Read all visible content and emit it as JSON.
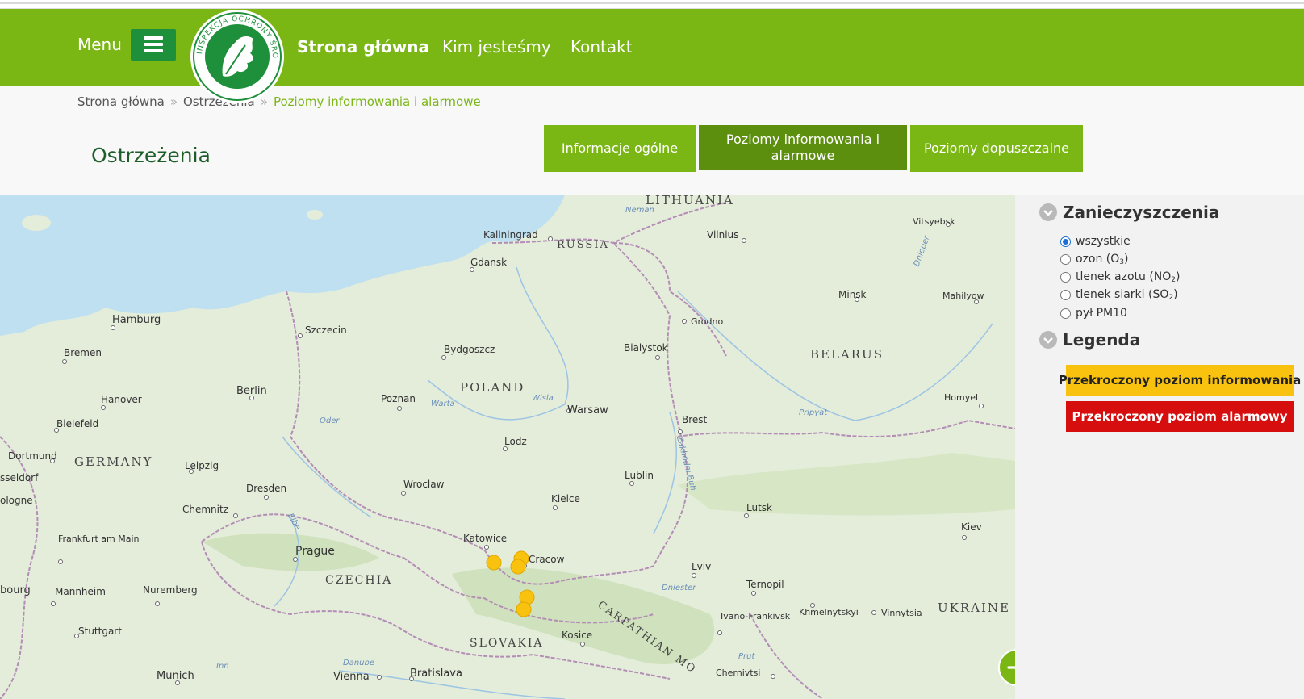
{
  "header": {
    "menu_label": "Menu",
    "logo_text": "INSPEKCJA OCHRONY ŚRODOWISKA",
    "nav": [
      {
        "label": "Strona główna"
      },
      {
        "label": "Kim jesteśmy"
      },
      {
        "label": "Kontakt"
      }
    ]
  },
  "breadcrumb": {
    "items": [
      "Strona główna",
      "Ostrzeżenia"
    ],
    "current": "Poziomy informowania i alarmowe",
    "separator": "»"
  },
  "page": {
    "title": "Ostrzeżenia",
    "tabs": [
      {
        "label": "Informacje ogólne",
        "active": false
      },
      {
        "label": "Poziomy informowania i alarmowe",
        "active": true
      },
      {
        "label": "Poziomy dopuszczalne",
        "active": false
      }
    ]
  },
  "sidebar": {
    "pollutants": {
      "title": "Zanieczyszczenia",
      "options": [
        {
          "label": "wszystkie",
          "checked": true
        },
        {
          "label": "ozon (O",
          "sub": "3",
          "tail": ")",
          "checked": false
        },
        {
          "label": "tlenek azotu (NO",
          "sub": "2",
          "tail": ")",
          "checked": false
        },
        {
          "label": "tlenek siarki (SO",
          "sub": "2",
          "tail": ")",
          "checked": false
        },
        {
          "label": "pył PM10",
          "checked": false
        }
      ]
    },
    "legend": {
      "title": "Legenda",
      "info_label": "Przekroczony poziom informowania",
      "alarm_label": "Przekroczony poziom alarmowy",
      "info_color": "#f9c20f",
      "alarm_color": "#d60e0e"
    }
  },
  "map": {
    "countries": [
      "LITHUANIA",
      "RUSSIA",
      "BELARUS",
      "POLAND",
      "GERMANY",
      "CZECHIA",
      "SLOVAKIA",
      "UKRAINE",
      "CARPATHIAN MO"
    ],
    "cities": [
      "Kaliningrad",
      "Vilnius",
      "Vitsyebsk",
      "Gdansk",
      "Minsk",
      "Mahilyow",
      "Hamburg",
      "Szczecin",
      "Grodno",
      "Bremen",
      "Bydgoszcz",
      "Bialystok",
      "Berlin",
      "Poznan",
      "Warsaw",
      "Hanover",
      "Brest",
      "Homyel",
      "Bielefeld",
      "Lodz",
      "Dortmund",
      "Leipzig",
      "sseldorf",
      "Wroclaw",
      "Lublin",
      "Dresden",
      "ologne",
      "Kielce",
      "Chemnitz",
      "Lutsk",
      "Kiev",
      "Frankfurt am Main",
      "Prague",
      "Katowice",
      "Cracow",
      "Lviv",
      "Ternopil",
      "bourg",
      "Mannheim",
      "Nuremberg",
      "Khmelnytskyi",
      "Vinnytsia",
      "Ivano-Frankivsk",
      "Stuttgart",
      "Kosice",
      "Munich",
      "Vienna",
      "Bratislava",
      "Chernivtsi"
    ],
    "rivers": [
      "Neman",
      "Warta",
      "Wisla",
      "Oder",
      "Pripyat",
      "Dnieper",
      "Zakhodni Buh",
      "Elbe",
      "Danube",
      "Dniester",
      "Prut",
      "Inn"
    ],
    "marker_color": "#f9c20f",
    "stations": [
      {
        "name": "station-1",
        "level": "info"
      },
      {
        "name": "station-2",
        "level": "info"
      },
      {
        "name": "station-3",
        "level": "info"
      },
      {
        "name": "station-4",
        "level": "info"
      },
      {
        "name": "station-5",
        "level": "info"
      }
    ]
  }
}
